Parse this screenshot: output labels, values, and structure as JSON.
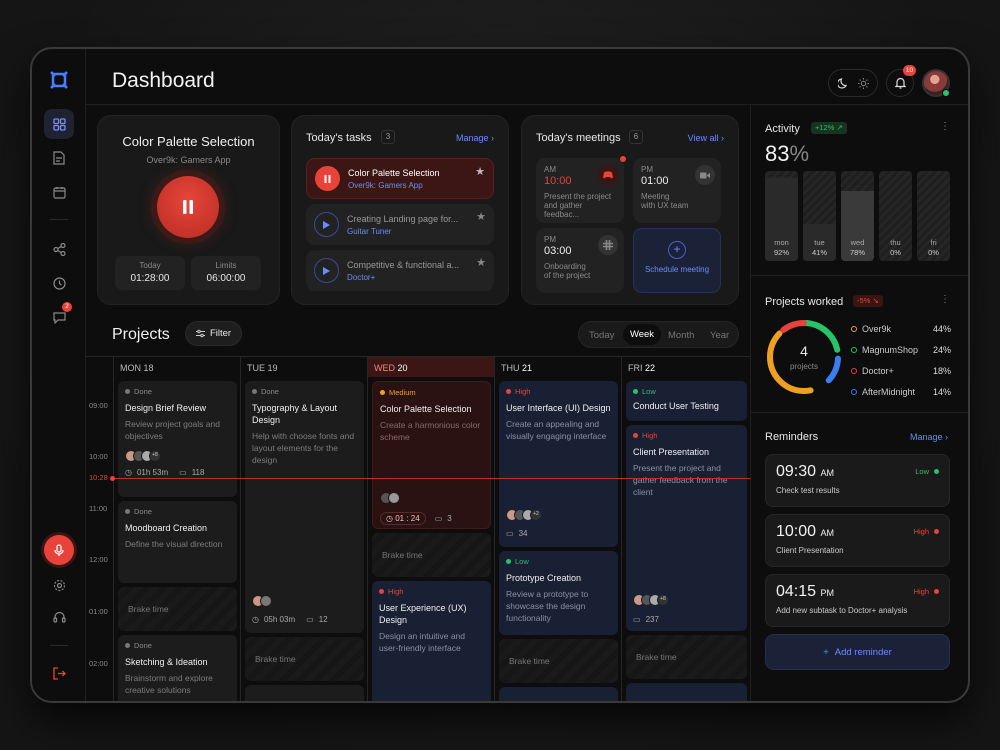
{
  "header": {
    "title": "Dashboard",
    "notification_count": "10"
  },
  "sidebar": {
    "chat_badge": "2"
  },
  "current_task": {
    "title": "Color Palette Selection",
    "subtitle": "Over9k: Gamers App",
    "today_label": "Today",
    "today_value": "01:28:00",
    "limits_label": "Limits",
    "limits_value": "06:00:00"
  },
  "tasks": {
    "title": "Today's tasks",
    "count": "3",
    "manage": "Manage",
    "items": [
      {
        "title": "Color Palette Selection",
        "project": "Over9k: Gamers App"
      },
      {
        "title": "Creating Landing page for...",
        "project": "Guitar Tuner"
      },
      {
        "title": "Competitive & functional a...",
        "project": "Doctor+"
      }
    ]
  },
  "meetings": {
    "title": "Today's meetings",
    "count": "6",
    "view_all": "View all",
    "items": [
      {
        "ampm": "AM",
        "time": "10:00",
        "desc1": "Present the project",
        "desc2": "and gather feedbac..."
      },
      {
        "ampm": "PM",
        "time": "01:00",
        "desc1": "Meeting",
        "desc2": "with UX team"
      },
      {
        "ampm": "PM",
        "time": "03:00",
        "desc1": "Onboarding",
        "desc2": "of the project"
      }
    ],
    "schedule": "Schedule meeting"
  },
  "projects": {
    "title": "Projects",
    "filter": "Filter",
    "views": [
      "Today",
      "Week",
      "Month",
      "Year"
    ],
    "days": [
      "MON 18",
      "TUE 19",
      "WED",
      "20",
      "THU",
      "21",
      "FRI",
      "22"
    ],
    "times": [
      "09:00",
      "10:00",
      "10:28",
      "11:00",
      "12:00",
      "01:00",
      "02:00"
    ],
    "brake": "Brake time",
    "cards": {
      "c1": {
        "status": "Done",
        "title": "Design Brief Review",
        "desc": "Review project goals and objectives",
        "more": "+8",
        "time": "01h 53m",
        "comments": "118"
      },
      "c2": {
        "status": "Done",
        "title": "Moodboard Creation",
        "desc": "Define the visual direction"
      },
      "c3": {
        "status": "Done",
        "title": "Sketching & Ideation",
        "desc": "Brainstorm and explore creative solutions"
      },
      "c4": {
        "status": "Done",
        "title": "Typography & Layout Design",
        "desc": "Help with choose fonts and layout elements for the design",
        "time": "05h 03m",
        "comments": "12"
      },
      "c5": {
        "status": "Medium",
        "title": "Color Palette Selection",
        "desc": "Create a harmonious color scheme",
        "time": "01 : 24",
        "comments": "3"
      },
      "c6": {
        "status": "High",
        "title": "User Experience (UX) Design",
        "desc": "Design an intuitive and user-friendly interface"
      },
      "c7": {
        "status": "High",
        "title": "User Interface (UI) Design",
        "desc": "Create an appealing and visually engaging interface",
        "more": "+2",
        "comments": "34"
      },
      "c8": {
        "status": "Low",
        "title": "Prototype Creation",
        "desc": "Review a prototype to showcase the design functionality"
      },
      "c9": {
        "status": "Low",
        "title": "Conduct User Testing"
      },
      "c10": {
        "status": "High",
        "title": "Client Presentation",
        "desc": "Present the project and gather feedback from the client",
        "more": "+8",
        "comments": "237"
      }
    }
  },
  "activity": {
    "title": "Activity",
    "change": "+12%",
    "value": "83",
    "unit": "%",
    "bars": [
      {
        "day": "mon",
        "pct": "92%",
        "fill": 0.92
      },
      {
        "day": "tue",
        "pct": "41%",
        "fill": 0.41
      },
      {
        "day": "wed",
        "pct": "78%",
        "fill": 0.78
      },
      {
        "day": "thu",
        "pct": "0%",
        "fill": 0
      },
      {
        "day": "fri",
        "pct": "0%",
        "fill": 0
      }
    ]
  },
  "projects_worked": {
    "title": "Projects worked",
    "change": "-5%",
    "total": "4",
    "total_label": "projects",
    "items": [
      {
        "name": "Over9k",
        "pct": "44%",
        "color": "#f0a020"
      },
      {
        "name": "MagnumShop",
        "pct": "24%",
        "color": "#27c36a"
      },
      {
        "name": "Doctor+",
        "pct": "18%",
        "color": "#e8433a"
      },
      {
        "name": "AfterMidnight",
        "pct": "14%",
        "color": "#3b7cf0"
      }
    ]
  },
  "reminders": {
    "title": "Reminders",
    "manage": "Manage",
    "add": "Add reminder",
    "items": [
      {
        "time": "09:30",
        "ampm": "AM",
        "desc": "Check test results",
        "priority": "Low"
      },
      {
        "time": "10:00",
        "ampm": "AM",
        "desc": "Client Presentation",
        "priority": "High"
      },
      {
        "time": "04:15",
        "ampm": "PM",
        "desc": "Add new subtask  to Doctor+ analysis",
        "priority": "High"
      }
    ]
  },
  "colors": {
    "accent": "#3b5bff",
    "red": "#e8433a",
    "green": "#27c36a",
    "orange": "#f0a020",
    "blue": "#3b7cf0"
  }
}
